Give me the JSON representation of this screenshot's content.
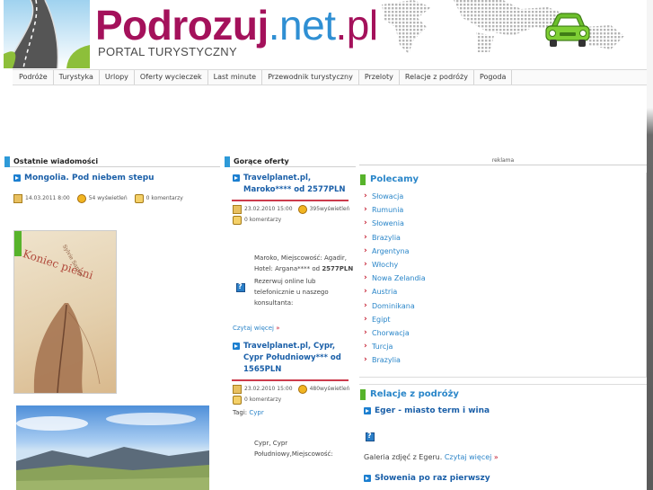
{
  "header": {
    "title_part1": "Podrozuj",
    "title_part2": ".net",
    "title_part3": ".pl",
    "subtitle": "PORTAL TURYSTYCZNY"
  },
  "nav": {
    "items": [
      "Podróże",
      "Turystyka",
      "Urlopy",
      "Oferty wycieczek",
      "Last minute",
      "Przewodnik turystyczny",
      "Przeloty",
      "Relacje z podróży",
      "Pogoda"
    ]
  },
  "col1": {
    "heading": "Ostatnie wiadomości",
    "article": {
      "title": "Mongolia. Pod niebem stepu",
      "date": "14.03.2011 8:00",
      "views": "54 wyświetleń",
      "comments": "0 komentarzy"
    },
    "book_cover": {
      "title": "Koniec pieśni",
      "author": "Sylvie Santer"
    }
  },
  "col2": {
    "heading": "Gorące oferty",
    "offer1": {
      "title": "Travelplanet.pl, Maroko**** od 2577PLN",
      "date": "23.02.2010 15:00",
      "views": "395",
      "views_suffix": "wyświetleń",
      "comments": "0 komentarzy",
      "body": "Maroko, Miejscowość: Agadir, Hotel: Argana**** od ",
      "price": "2577PLN",
      "body2": "Rezerwuj online lub telefonicznie u naszego konsultanta:",
      "more": "Czytaj więcej",
      "raquo": "»"
    },
    "offer2": {
      "title": "Travelplanet.pl, Cypr, Cypr Południowy*** od 1565PLN",
      "date": "23.02.2010 15:00",
      "views": "480",
      "views_suffix": "wyświetleń",
      "comments": "0 komentarzy",
      "tags_label": "Tagi:",
      "tag": "Cypr",
      "body": "Cypr, Cypr Południowy,Miejscowość:"
    }
  },
  "col3": {
    "ad_label": "reklama",
    "polecamy": {
      "heading": "Polecamy",
      "items": [
        "Słowacja",
        "Rumunia",
        "Słowenia",
        "Brazylia",
        "Argentyna",
        "Włochy",
        "Nowa Zelandia",
        "Austria",
        "Dominikana",
        "Egipt",
        "Chorwacja",
        "Turcja",
        "Brazylia"
      ]
    },
    "relacje": {
      "heading": "Relacje z podróży",
      "item1_title": "Eger - miasto term i wina",
      "item1_text": "Galeria zdjęć z Egeru.",
      "item1_more": "Czytaj więcej",
      "raquo": "»",
      "item2_title": "Słowenia po raz pierwszy"
    }
  },
  "colors": {
    "brand_magenta": "#a4115b",
    "brand_blue": "#2f8fd3",
    "accent_green": "#57b32b",
    "link_blue": "#2a86c9",
    "rule_red": "#c3192d"
  }
}
